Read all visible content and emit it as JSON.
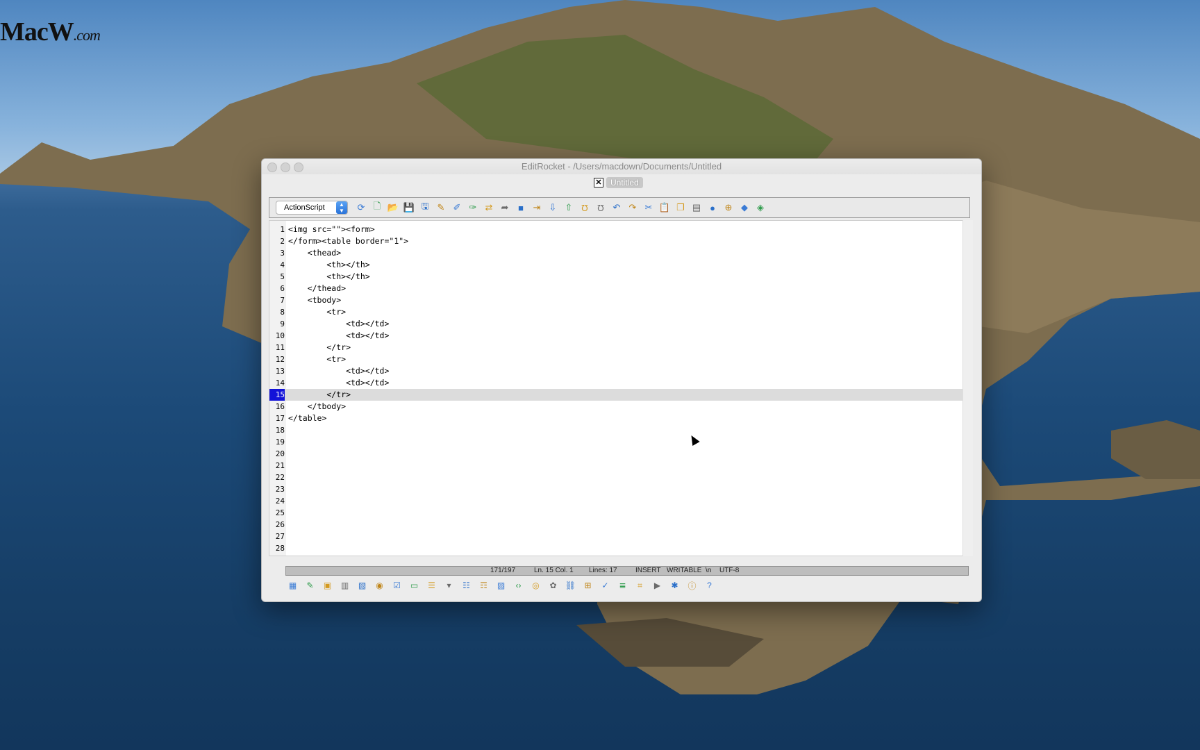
{
  "desktop": {
    "logo_text": "MacW",
    "logo_domain": ".com"
  },
  "window": {
    "title": "EditRocket - /Users/macdown/Documents/Untitled",
    "tab_label": "Untitled"
  },
  "toolbar": {
    "language": "ActionScript",
    "icons": [
      "refresh-icon",
      "new-file-icon",
      "open-folder-icon",
      "save-icon",
      "save-all-icon",
      "wand-icon",
      "wand-2-icon",
      "wand-3-icon",
      "replace-icon",
      "goto-icon",
      "block-icon",
      "insert-line-icon",
      "move-down-icon",
      "move-up-icon",
      "bracket-icon",
      "bracket-2-icon",
      "undo-icon",
      "redo-icon",
      "cut-icon",
      "paste-icon",
      "copy-icon",
      "window-icon",
      "globe-icon",
      "add-icon",
      "plugin-icon",
      "plugin-2-icon"
    ]
  },
  "editor": {
    "current_line": 15,
    "lines": [
      "<img src=\"\"><form>",
      "</form><table border=\"1\">",
      "    <thead>",
      "        <th></th>",
      "        <th></th>",
      "    </thead>",
      "    <tbody>",
      "        <tr>",
      "            <td></td>",
      "            <td></td>",
      "        </tr>",
      "        <tr>",
      "            <td></td>",
      "            <td></td>",
      "        </tr>",
      "    </tbody>",
      "</table>",
      "",
      "",
      "",
      "",
      "",
      "",
      "",
      "",
      "",
      "",
      ""
    ]
  },
  "status": {
    "position": "171/197",
    "line_col": "Ln. 15 Col. 1",
    "lines": "Lines: 17",
    "mode": "INSERT",
    "writable": "WRITABLE  \\n",
    "encoding": "UTF-8"
  },
  "bottom_toolbar": {
    "icons": [
      "table-icon",
      "pencil-icon",
      "image-icon",
      "frame-icon",
      "layout-icon",
      "radio-icon",
      "checkbox-icon",
      "button-ok-icon",
      "textarea-icon",
      "select-icon",
      "list-icon",
      "ordered-list-icon",
      "form-icon",
      "code-tag-icon",
      "eye-icon",
      "color-icon",
      "link-icon",
      "tree-icon",
      "validate-icon",
      "outline-icon",
      "binary-icon",
      "run-icon",
      "debug-icon",
      "info-icon",
      "help-icon"
    ]
  }
}
